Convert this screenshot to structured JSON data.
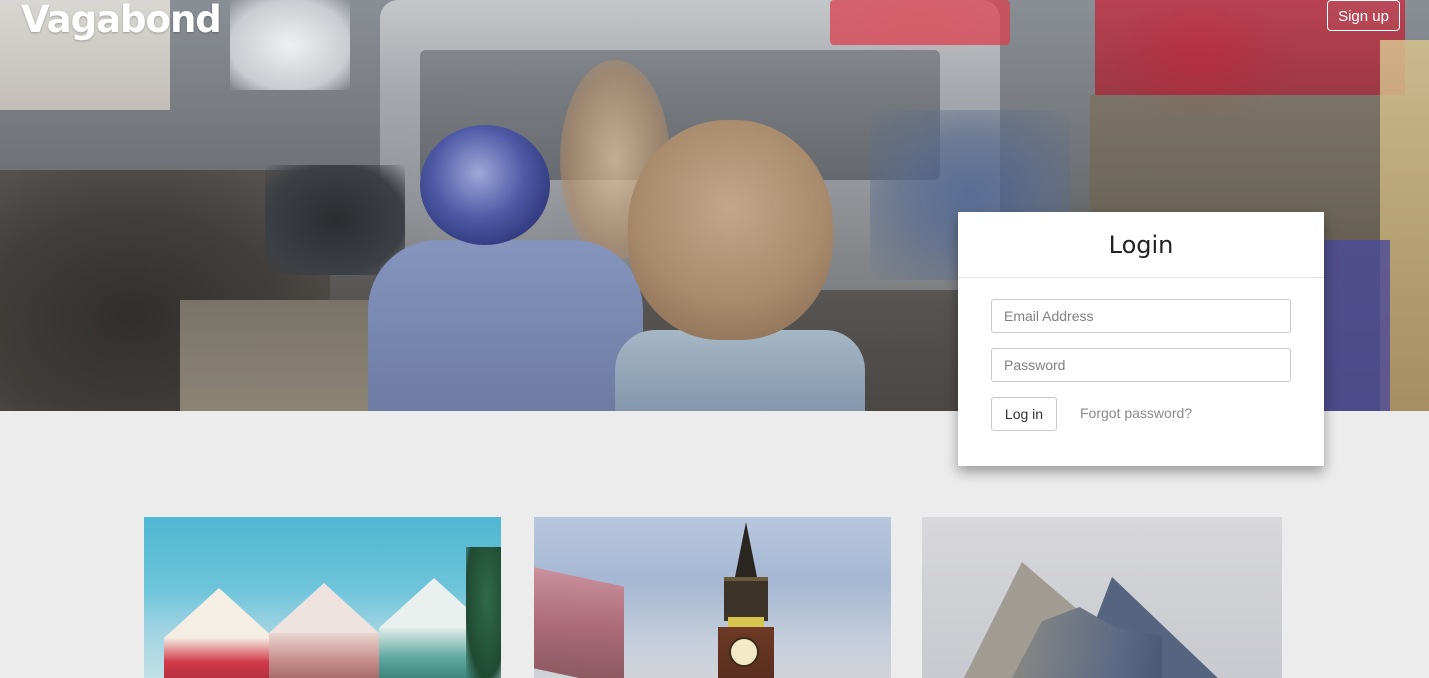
{
  "header": {
    "brand": "Vagabond",
    "signup_label": "Sign up"
  },
  "login": {
    "title": "Login",
    "email_placeholder": "Email Address",
    "password_placeholder": "Password",
    "login_label": "Log in",
    "forgot_label": "Forgot password?"
  },
  "destinations": [
    {
      "image": "painted-ladies-houses"
    },
    {
      "image": "big-ben-clock-tower"
    },
    {
      "image": "rock-of-gibraltar"
    }
  ],
  "colors": {
    "page_background": "#ececec",
    "card_background": "#ffffff",
    "text_muted": "#8a8a8a",
    "brand_text": "#ffffff"
  }
}
